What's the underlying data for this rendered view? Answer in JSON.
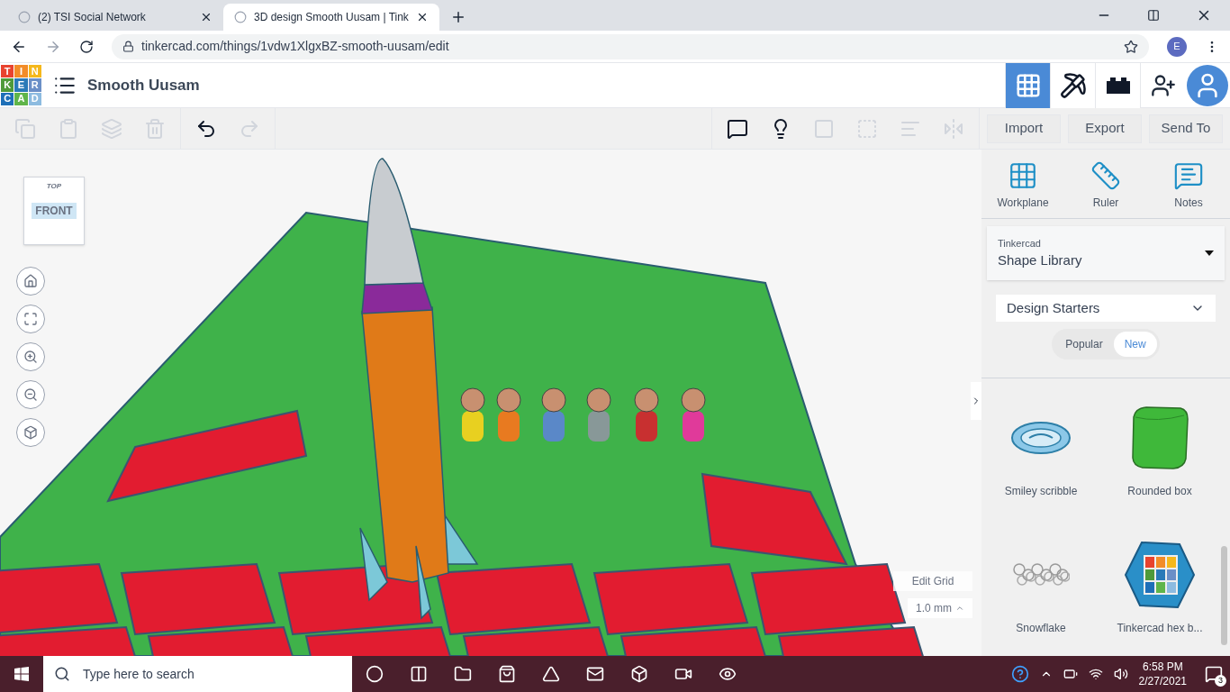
{
  "browser": {
    "tabs": [
      {
        "title": "(2) TSI Social Network",
        "selected": false
      },
      {
        "title": "3D design Smooth Uusam | Tink",
        "selected": true
      }
    ],
    "url": "tinkercad.com/things/1vdw1XlgxBZ-smooth-uusam/edit",
    "profile_initial": "E"
  },
  "app": {
    "logo_letters": [
      "T",
      "I",
      "N",
      "K",
      "E",
      "R",
      "C",
      "A",
      "D"
    ],
    "title": "Smooth Uusam",
    "header_buttons": [
      {
        "kind": "grid",
        "selected": true
      },
      {
        "kind": "pickaxe",
        "selected": false
      },
      {
        "kind": "bricks",
        "selected": false
      }
    ]
  },
  "toolbar": {
    "edit_actions": [
      {
        "kind": "copy",
        "disabled": true
      },
      {
        "kind": "paste",
        "disabled": true
      },
      {
        "kind": "duplicate",
        "disabled": true
      },
      {
        "kind": "delete",
        "disabled": true
      }
    ],
    "history_actions": [
      {
        "kind": "undo",
        "disabled": false
      },
      {
        "kind": "redo",
        "disabled": true
      }
    ],
    "shape_actions": [
      {
        "kind": "notes",
        "disabled": false
      },
      {
        "kind": "hint",
        "disabled": false
      },
      {
        "kind": "group",
        "disabled": true
      },
      {
        "kind": "ungroup",
        "disabled": true
      },
      {
        "kind": "align",
        "disabled": true
      },
      {
        "kind": "mirror",
        "disabled": true
      }
    ],
    "buttons": [
      "Import",
      "Export",
      "Send To"
    ]
  },
  "view_cube": {
    "top": "TOP",
    "front": "FRONT"
  },
  "grid": {
    "edit_label": "Edit Grid",
    "snap": "1.0 mm"
  },
  "panel": {
    "tools": [
      {
        "kind": "workplane",
        "label": "Workplane"
      },
      {
        "kind": "ruler",
        "label": "Ruler"
      },
      {
        "kind": "notes",
        "label": "Notes"
      }
    ],
    "library": {
      "label": "Tinkercad",
      "value": "Shape Library"
    },
    "category": "Design Starters",
    "sort_tabs": [
      {
        "label": "Popular",
        "selected": false
      },
      {
        "label": "New",
        "selected": true
      }
    ],
    "shapes": [
      {
        "kind": "scribble",
        "name": "Smiley scribble"
      },
      {
        "kind": "box",
        "name": "Rounded box"
      },
      {
        "kind": "snowflake",
        "name": "Snowflake"
      },
      {
        "kind": "hex",
        "name": "Tinkercad hex b..."
      }
    ]
  },
  "taskbar": {
    "search_placeholder": "Type here to search",
    "time": "6:58 PM",
    "date": "2/27/2021",
    "notifications": "3"
  }
}
